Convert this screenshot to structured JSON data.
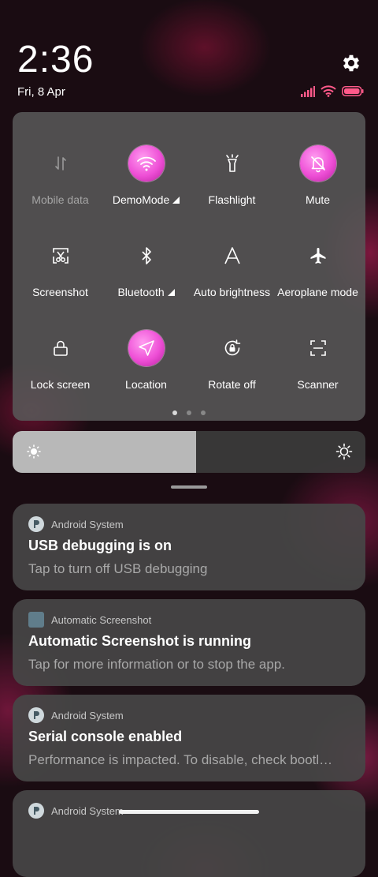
{
  "header": {
    "time": "2:36",
    "date": "Fri, 8 Apr"
  },
  "status_icons": [
    "signal-icon",
    "wifi-icon",
    "battery-icon"
  ],
  "colors": {
    "accent": "#ee4fd6",
    "status_pink": "#ff5a8a"
  },
  "quick_settings": {
    "tiles": [
      {
        "label": "Mobile data",
        "icon": "mobile-data-icon",
        "state": "unavailable"
      },
      {
        "label": "DemoMode",
        "icon": "wifi-icon",
        "state": "on",
        "expandable": true
      },
      {
        "label": "Flashlight",
        "icon": "flashlight-icon",
        "state": "off"
      },
      {
        "label": "Mute",
        "icon": "mute-bell-icon",
        "state": "on"
      },
      {
        "label": "Screenshot",
        "icon": "screenshot-icon",
        "state": "off"
      },
      {
        "label": "Bluetooth",
        "icon": "bluetooth-icon",
        "state": "off",
        "expandable": true
      },
      {
        "label": "Auto brightness",
        "icon": "auto-brightness-icon",
        "state": "off"
      },
      {
        "label": "Aeroplane mode",
        "icon": "aeroplane-icon",
        "state": "off"
      },
      {
        "label": "Lock screen",
        "icon": "lock-icon",
        "state": "off"
      },
      {
        "label": "Location",
        "icon": "location-icon",
        "state": "on"
      },
      {
        "label": "Rotate off",
        "icon": "rotate-lock-icon",
        "state": "off"
      },
      {
        "label": "Scanner",
        "icon": "scanner-icon",
        "state": "off"
      }
    ],
    "pages": 3,
    "current_page": 1
  },
  "brightness": {
    "level": 0.52
  },
  "notifications": [
    {
      "app": "Android System",
      "icon": "android-system-icon",
      "title": "USB debugging is on",
      "body": "Tap to turn off USB debugging"
    },
    {
      "app": "Automatic Screenshot",
      "icon": "automatic-screenshot-icon",
      "title": "Automatic Screenshot is running",
      "body": "Tap for more information or to stop the app."
    },
    {
      "app": "Android System",
      "icon": "android-system-icon",
      "title": "Serial console enabled",
      "body": "Performance is impacted. To disable, check bootl…"
    },
    {
      "app": "Android System",
      "icon": "android-system-icon",
      "title": "",
      "body": ""
    }
  ]
}
